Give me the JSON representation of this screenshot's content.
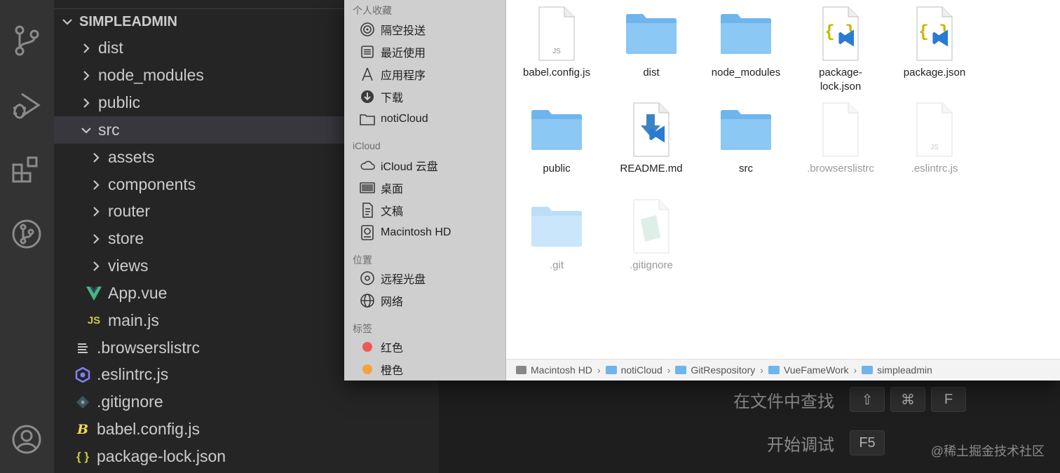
{
  "explorer": {
    "root": "SIMPLEADMIN",
    "items": [
      {
        "label": "dist",
        "icon": "chevron-right-icon"
      },
      {
        "label": "node_modules",
        "icon": "chevron-right-icon"
      },
      {
        "label": "public",
        "icon": "chevron-right-icon"
      },
      {
        "label": "src",
        "icon": "chevron-down-icon"
      },
      {
        "label": "assets",
        "icon": "chevron-right-icon"
      },
      {
        "label": "components",
        "icon": "chevron-right-icon"
      },
      {
        "label": "router",
        "icon": "chevron-right-icon"
      },
      {
        "label": "store",
        "icon": "chevron-right-icon"
      },
      {
        "label": "views",
        "icon": "chevron-right-icon"
      },
      {
        "label": "App.vue",
        "icon": "vue-icon"
      },
      {
        "label": "main.js",
        "icon": "js-icon",
        "badge": "JS"
      },
      {
        "label": ".browserslistrc",
        "icon": "lines-icon"
      },
      {
        "label": ".eslintrc.js",
        "icon": "eslint-icon"
      },
      {
        "label": ".gitignore",
        "icon": "git-icon"
      },
      {
        "label": "babel.config.js",
        "icon": "babel-icon",
        "badge": "B"
      },
      {
        "label": "package-lock.json",
        "icon": "json-icon",
        "badge": "{ }"
      }
    ]
  },
  "hints": {
    "find_in_files": "在文件中查找",
    "find_keys": [
      "⇧",
      "⌘",
      "F"
    ],
    "start_debug": "开始调试",
    "debug_key": "F5"
  },
  "watermark": "@稀土掘金技术社区",
  "finder": {
    "sidebar": {
      "favorites_header": "个人收藏",
      "favorites": [
        {
          "label": "隔空投送",
          "icon": "airdrop-icon"
        },
        {
          "label": "最近使用",
          "icon": "recents-icon"
        },
        {
          "label": "应用程序",
          "icon": "applications-icon"
        },
        {
          "label": "下载",
          "icon": "downloads-icon"
        },
        {
          "label": "notiCloud",
          "icon": "folder-icon"
        }
      ],
      "icloud_header": "iCloud",
      "icloud": [
        {
          "label": "iCloud 云盘",
          "icon": "cloud-icon"
        },
        {
          "label": "桌面",
          "icon": "desktop-icon"
        },
        {
          "label": "文稿",
          "icon": "document-icon"
        },
        {
          "label": "Macintosh HD",
          "icon": "harddisk-icon"
        }
      ],
      "locations_header": "位置",
      "locations": [
        {
          "label": "远程光盘",
          "icon": "disc-icon"
        },
        {
          "label": "网络",
          "icon": "network-icon"
        }
      ],
      "tags_header": "标签",
      "tags": [
        {
          "label": "红色",
          "color": "#ed5a55"
        },
        {
          "label": "橙色",
          "color": "#f3a33d"
        }
      ]
    },
    "files": [
      {
        "label": "babel.config.js",
        "kind": "js-doc",
        "dim": false,
        "doc_tag": "JS"
      },
      {
        "label": "dist",
        "kind": "folder",
        "dim": false
      },
      {
        "label": "node_modules",
        "kind": "folder",
        "dim": false
      },
      {
        "label": "package-\nlock.json",
        "kind": "json-doc",
        "dim": false,
        "doc_tag": "{ }"
      },
      {
        "label": "package.json",
        "kind": "json-doc",
        "dim": false,
        "doc_tag": "{ }"
      },
      {
        "label": "public",
        "kind": "folder",
        "dim": false
      },
      {
        "label": "README.md",
        "kind": "md-doc",
        "dim": false
      },
      {
        "label": "src",
        "kind": "folder",
        "dim": false
      },
      {
        "label": ".browserslistrc",
        "kind": "blank-doc",
        "dim": true
      },
      {
        "label": ".eslintrc.js",
        "kind": "js-doc",
        "dim": true,
        "doc_tag": "JS"
      },
      {
        "label": ".git",
        "kind": "folder",
        "dim": true
      },
      {
        "label": ".gitignore",
        "kind": "text-doc",
        "dim": true
      }
    ],
    "path": [
      "Macintosh HD",
      "notiCloud",
      "GitRespository",
      "VueFameWork",
      "simpleadmin"
    ],
    "path_separator": "›"
  },
  "colors": {
    "vscode_bg": "#1e1e1e",
    "sidebar_bg": "#252526",
    "activity_bg": "#333333",
    "finder_folder": "#6fb5ec",
    "vue_green": "#41b883",
    "js_yellow": "#cbcb41",
    "eslint_purple": "#8080f2",
    "vscode_blue": "#2a7bd3"
  }
}
